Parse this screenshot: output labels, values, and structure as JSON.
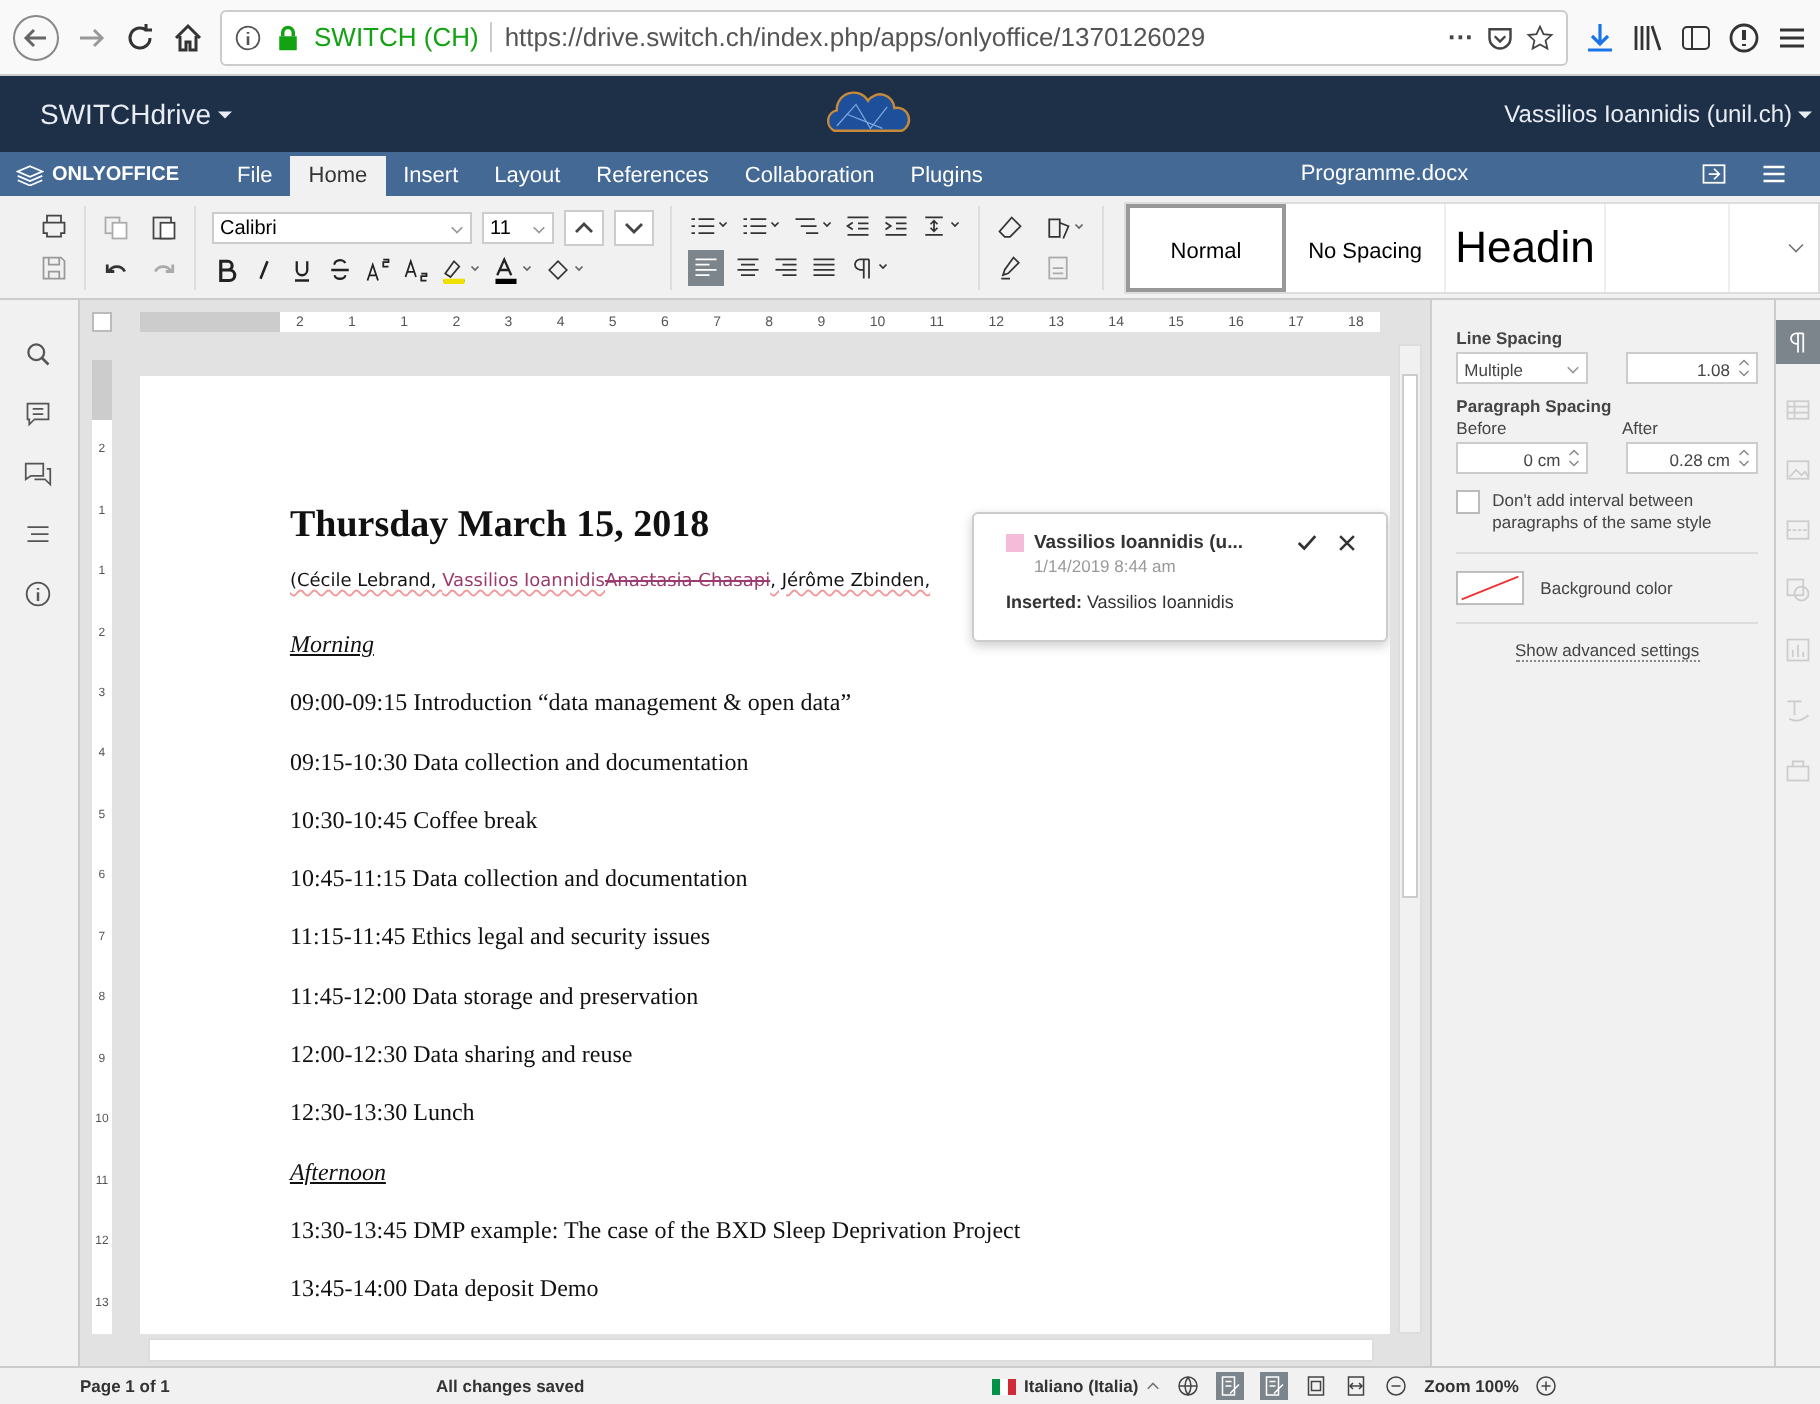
{
  "browser": {
    "site": "SWITCH (CH)",
    "url": "https://drive.switch.ch/index.php/apps/onlyoffice/1370126029",
    "more": "···"
  },
  "app_header": {
    "brand": "SWITCHdrive",
    "user": "Vassilios Ioannidis (unil.ch)"
  },
  "menu": {
    "logo": "ONLYOFFICE",
    "document_title": "Programme.docx",
    "tabs": [
      {
        "label": "File",
        "selected": false
      },
      {
        "label": "Home",
        "selected": true
      },
      {
        "label": "Insert",
        "selected": false
      },
      {
        "label": "Layout",
        "selected": false
      },
      {
        "label": "References",
        "selected": false
      },
      {
        "label": "Collaboration",
        "selected": false
      },
      {
        "label": "Plugins",
        "selected": false
      }
    ]
  },
  "toolbar": {
    "font": "Calibri",
    "size": "11",
    "styles": [
      {
        "label": "Normal",
        "kind": "normal",
        "selected": true
      },
      {
        "label": "No Spacing",
        "kind": "normal",
        "selected": false
      },
      {
        "label": "Headin",
        "kind": "heading",
        "selected": false
      }
    ]
  },
  "ruler": {
    "labels": [
      "2",
      "1",
      "1",
      "2",
      "3",
      "4",
      "5",
      "6",
      "7",
      "8",
      "9",
      "10",
      "11",
      "12",
      "13",
      "14",
      "15",
      "16",
      "17",
      "18"
    ],
    "vertical_labels": [
      "2",
      "1",
      "1",
      "2",
      "3",
      "4",
      "5",
      "6",
      "7",
      "8",
      "9",
      "10",
      "11",
      "12",
      "13"
    ]
  },
  "document": {
    "heading": "Thursday March 15, 2018",
    "attendees": [
      {
        "text": "(Cécile Lebrand, ",
        "kind": "normal"
      },
      {
        "text": "Vassilios Ioannidis",
        "kind": "inserted"
      },
      {
        "text": "Anastasia Chasapi",
        "kind": "deleted"
      },
      {
        "text": ", Jérôme Zbinden,",
        "kind": "normal"
      }
    ],
    "lines": [
      {
        "text": "Morning",
        "kind": "section"
      },
      {
        "text": "09:00-09:15  Introduction “data management & open data”",
        "kind": "item"
      },
      {
        "text": "09:15-10:30  Data collection and documentation",
        "kind": "item"
      },
      {
        "text": "10:30-10:45  Coffee break",
        "kind": "item"
      },
      {
        "text": "10:45-11:15  Data collection and documentation",
        "kind": "item"
      },
      {
        "text": "11:15-11:45  Ethics legal and security issues",
        "kind": "item"
      },
      {
        "text": "11:45-12:00  Data storage and preservation",
        "kind": "item"
      },
      {
        "text": "12:00-12:30  Data sharing and reuse",
        "kind": "item"
      },
      {
        "text": "12:30-13:30  Lunch",
        "kind": "item"
      },
      {
        "text": "Afternoon",
        "kind": "section"
      },
      {
        "text": "13:30-13:45  DMP example: The case of the BXD Sleep Deprivation Project",
        "kind": "item"
      },
      {
        "text": "13:45-14:00  Data deposit Demo",
        "kind": "item"
      }
    ]
  },
  "comment": {
    "author": "Vassilios Ioannidis (u...",
    "color": "#f4bcd9",
    "date": "1/14/2019 8:44 am",
    "text": "**Inserted:** Vassilios Ioannidis"
  },
  "settings": {
    "line_spacing": "Line Spacing",
    "mode": "Multiple",
    "value": "1.08",
    "paragraph_spacing": "Paragraph Spacing",
    "before_label": "Before",
    "before": "0 cm",
    "after_label": "After",
    "after": "0.28 cm",
    "checkbox": {
      "label": "Don't add interval between paragraphs of the same style",
      "checked": false
    },
    "background_color": "Background color",
    "advanced": "Show advanced settings"
  },
  "status_bar": {
    "page": "Page 1 of 1",
    "saved": "All changes saved",
    "language": "Italiano (Italia)",
    "zoom": "Zoom 100%"
  }
}
